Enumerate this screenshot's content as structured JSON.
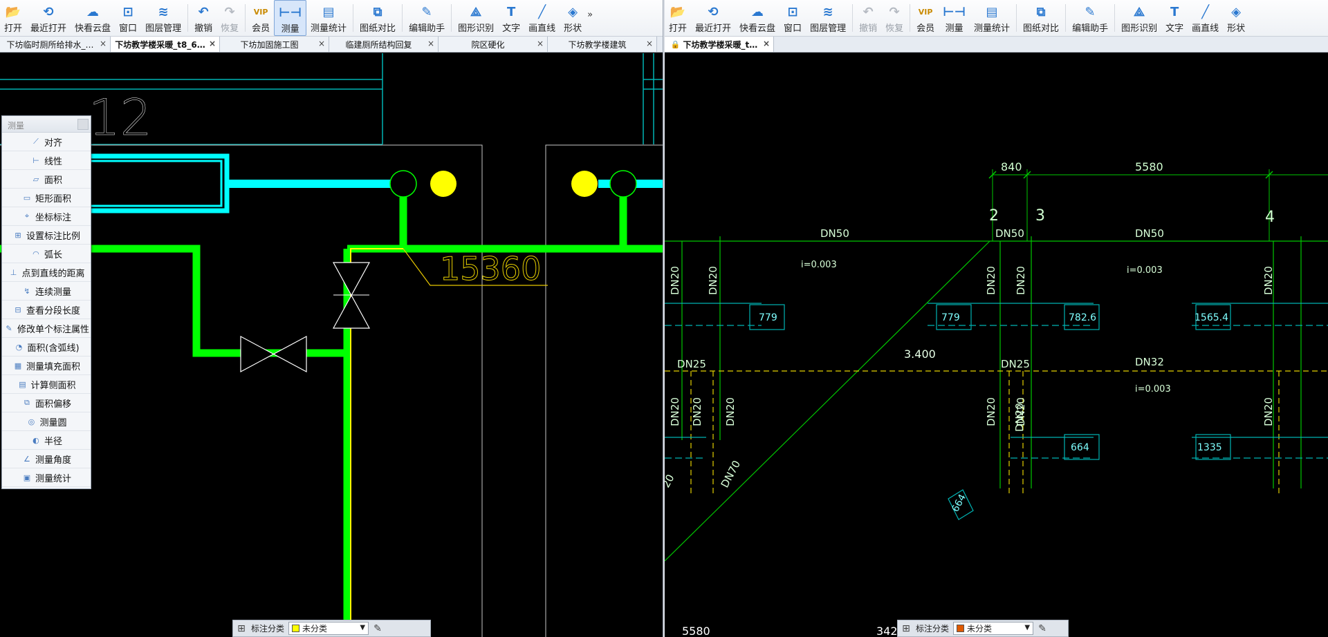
{
  "left": {
    "toolbar": [
      {
        "label": "打开",
        "icon": "folder-open-icon",
        "state": "normal"
      },
      {
        "label": "最近打开",
        "icon": "recent-icon",
        "state": "normal"
      },
      {
        "label": "快看云盘",
        "icon": "cloud-icon",
        "state": "normal"
      },
      {
        "label": "窗口",
        "icon": "window-icon",
        "state": "normal"
      },
      {
        "label": "图层管理",
        "icon": "layers-icon",
        "state": "normal"
      },
      {
        "label": "撤销",
        "icon": "undo-icon",
        "state": "normal"
      },
      {
        "label": "恢复",
        "icon": "redo-icon",
        "state": "disabled"
      },
      {
        "label": "会员",
        "icon": "vip-icon",
        "state": "normal"
      },
      {
        "label": "测量",
        "icon": "measure-icon",
        "state": "active"
      },
      {
        "label": "测量统计",
        "icon": "measure-stats-icon",
        "state": "normal"
      },
      {
        "label": "图纸对比",
        "icon": "compare-icon",
        "state": "normal"
      },
      {
        "label": "编辑助手",
        "icon": "edit-assistant-icon",
        "state": "normal"
      },
      {
        "label": "图形识别",
        "icon": "shape-recognize-icon",
        "state": "normal"
      },
      {
        "label": "文字",
        "icon": "text-icon",
        "state": "normal"
      },
      {
        "label": "画直线",
        "icon": "line-icon",
        "state": "normal"
      },
      {
        "label": "形状",
        "icon": "shape-icon",
        "state": "normal"
      }
    ],
    "more": "»",
    "tabs": [
      {
        "label": "下坊临时厕所给排水_…",
        "active": false
      },
      {
        "label": "下坊教学楼采暖_t8_6…",
        "active": true
      },
      {
        "label": "下坊加固施工图",
        "active": false
      },
      {
        "label": "临建厕所结构回复",
        "active": false
      },
      {
        "label": "院区硬化",
        "active": false
      },
      {
        "label": "下坊教学楼建筑",
        "active": false
      }
    ],
    "drawing": {
      "grid_label": "12",
      "dim": "15360"
    },
    "measure_panel": {
      "title": "测量",
      "items": [
        "对齐",
        "线性",
        "面积",
        "矩形面积",
        "坐标标注",
        "设置标注比例",
        "弧长",
        "点到直线的距离",
        "连续测量",
        "查看分段长度",
        "修改单个标注属性",
        "面积(含弧线)",
        "测量填充面积",
        "计算侧面积",
        "面积偏移",
        "测量圆",
        "半径",
        "测量角度",
        "测量统计"
      ]
    },
    "status": {
      "label": "标注分类",
      "value": "未分类",
      "color": "#ffff00"
    }
  },
  "right": {
    "toolbar": [
      {
        "label": "打开",
        "icon": "folder-open-icon",
        "state": "normal"
      },
      {
        "label": "最近打开",
        "icon": "recent-icon",
        "state": "normal"
      },
      {
        "label": "快看云盘",
        "icon": "cloud-icon",
        "state": "normal"
      },
      {
        "label": "窗口",
        "icon": "window-icon",
        "state": "normal"
      },
      {
        "label": "图层管理",
        "icon": "layers-icon",
        "state": "normal"
      },
      {
        "label": "撤销",
        "icon": "undo-icon",
        "state": "disabled"
      },
      {
        "label": "恢复",
        "icon": "redo-icon",
        "state": "disabled"
      },
      {
        "label": "会员",
        "icon": "vip-icon",
        "state": "normal"
      },
      {
        "label": "测量",
        "icon": "measure-icon",
        "state": "normal"
      },
      {
        "label": "测量统计",
        "icon": "measure-stats-icon",
        "state": "normal"
      },
      {
        "label": "图纸对比",
        "icon": "compare-icon",
        "state": "normal"
      },
      {
        "label": "编辑助手",
        "icon": "edit-assistant-icon",
        "state": "normal"
      },
      {
        "label": "图形识别",
        "icon": "shape-recognize-icon",
        "state": "normal"
      },
      {
        "label": "文字",
        "icon": "text-icon",
        "state": "normal"
      },
      {
        "label": "画直线",
        "icon": "line-icon",
        "state": "normal"
      },
      {
        "label": "形状",
        "icon": "shape-icon",
        "state": "normal"
      }
    ],
    "tabs": [
      {
        "label": "下坊教学楼采暖_t…",
        "active": true
      }
    ],
    "drawing": {
      "dims": [
        "840",
        "5580"
      ],
      "axes": [
        "2",
        "3",
        "4"
      ],
      "pipes": [
        "DN50",
        "DN50",
        "DN50",
        "DN20",
        "DN20",
        "DN20",
        "DN20",
        "DN20",
        "DN25",
        "DN25",
        "DN32",
        "DN20",
        "DN20",
        "DN20",
        "DN20",
        "DN20",
        "DN20",
        "DN20",
        "DN70",
        "20"
      ],
      "slopes": [
        "i=0.003",
        "i=0.003",
        "i=0.003"
      ],
      "radiators": [
        "779",
        "779",
        "782.6",
        "1565.4",
        "664",
        "1335",
        "664"
      ],
      "elev": "3.400",
      "bottom": [
        "5580",
        "342"
      ]
    },
    "status": {
      "label": "标注分类",
      "value": "未分类",
      "color": "#e05a00"
    }
  },
  "colors": {
    "cyan": "#00ffff",
    "green": "#00ff00",
    "yellow": "#ffff00",
    "dkgreen": "#00b400",
    "teal": "#00b0b0"
  }
}
